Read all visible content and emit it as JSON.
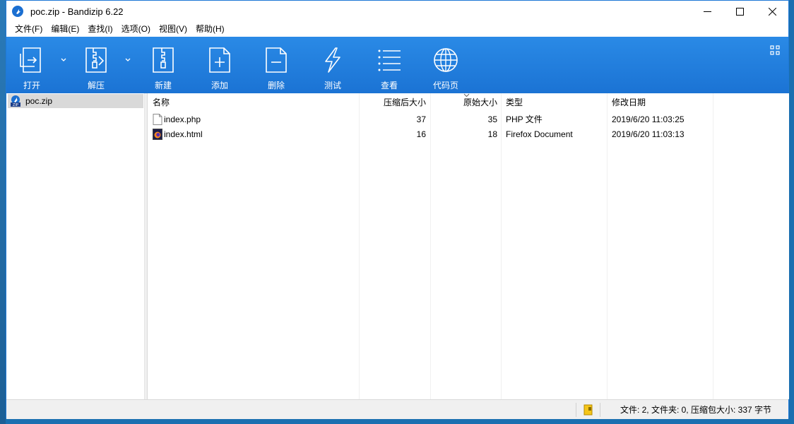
{
  "window": {
    "title": "poc.zip - Bandizip 6.22"
  },
  "menu": [
    "文件(F)",
    "编辑(E)",
    "查找(I)",
    "选项(O)",
    "视图(V)",
    "帮助(H)"
  ],
  "toolbar": {
    "open": "打开",
    "extract": "解压",
    "new": "新建",
    "add": "添加",
    "delete": "删除",
    "test": "测试",
    "view": "查看",
    "codepage": "代码页"
  },
  "tree": {
    "root": "poc.zip"
  },
  "list": {
    "columns": {
      "name": "名称",
      "packed": "压缩后大小",
      "original": "原始大小",
      "type": "类型",
      "modified": "修改日期"
    },
    "rows": [
      {
        "name": "index.php",
        "packed": "37",
        "original": "35",
        "type": "PHP 文件",
        "modified": "2019/6/20 11:03:25"
      },
      {
        "name": "index.html",
        "packed": "16",
        "original": "18",
        "type": "Firefox Document",
        "modified": "2019/6/20 11:03:13"
      }
    ]
  },
  "status": {
    "summary": "文件: 2, 文件夹: 0, 压缩包大小: 337 字节"
  },
  "colors": {
    "toolbar": "#1b73d4",
    "accent": "#1e78d6",
    "selection": "#d9d9d9"
  }
}
